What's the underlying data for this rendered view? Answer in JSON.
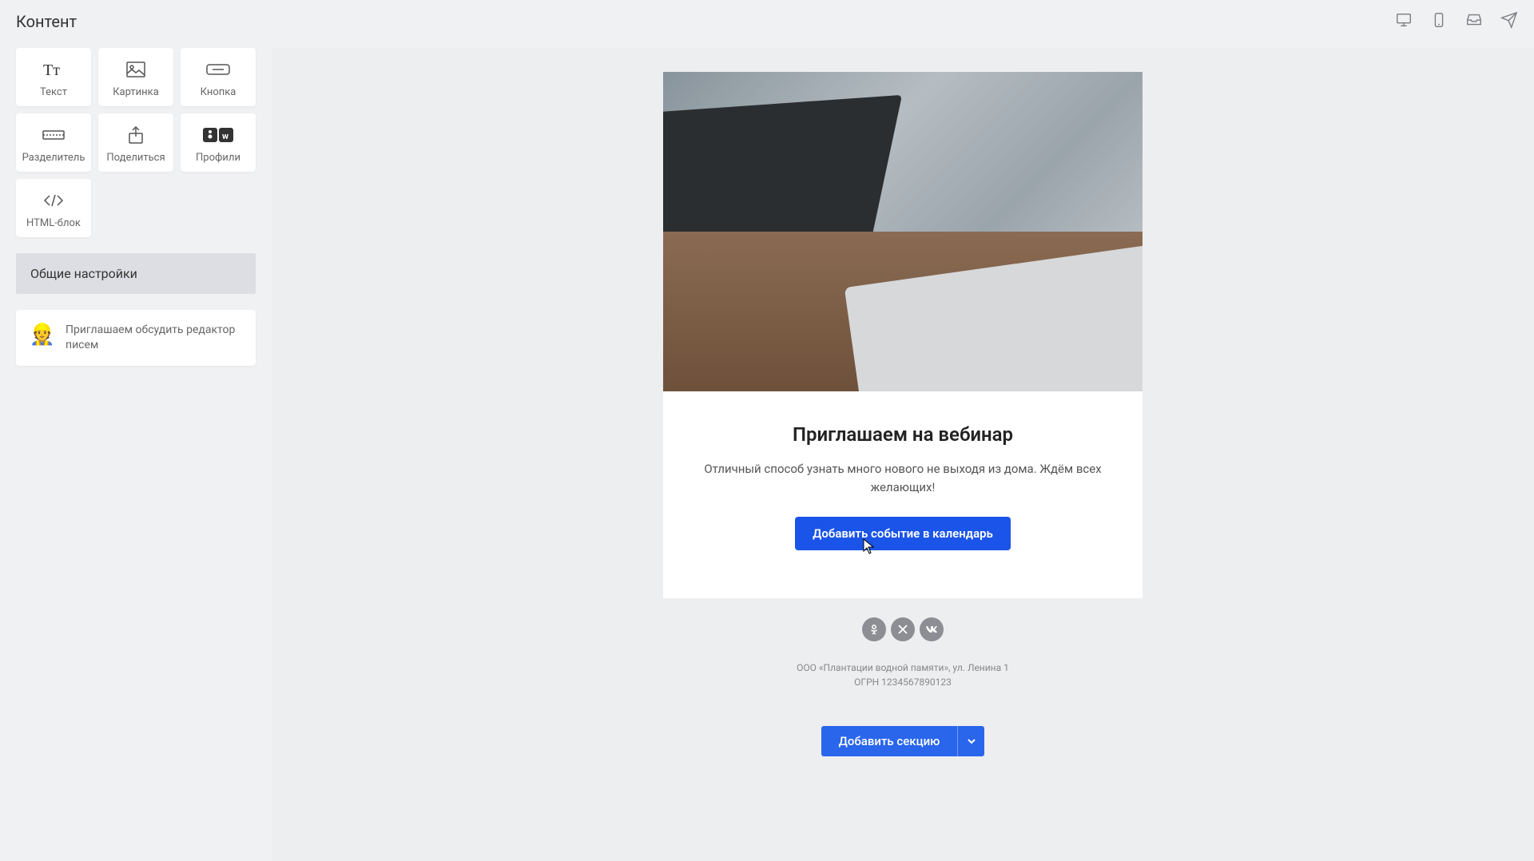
{
  "header": {
    "title": "Контент"
  },
  "blocks": [
    {
      "label": "Текст"
    },
    {
      "label": "Картинка"
    },
    {
      "label": "Кнопка"
    },
    {
      "label": "Разделитель"
    },
    {
      "label": "Поделиться"
    },
    {
      "label": "Профили"
    },
    {
      "label": "HTML-блок"
    }
  ],
  "settings_header": "Общие настройки",
  "feedback": {
    "text": "Приглашаем обсудить редактор писем"
  },
  "email": {
    "title": "Приглашаем на вебинар",
    "body": "Отличный способ узнать много нового не выходя из дома. Ждём всех желающих!",
    "cta": "Добавить событие в календарь"
  },
  "footer": {
    "line1": "ООО «Плантации водной памяти», ул. Ленина 1",
    "line2": "ОГРН 1234567890123"
  },
  "add_section": "Добавить секцию"
}
